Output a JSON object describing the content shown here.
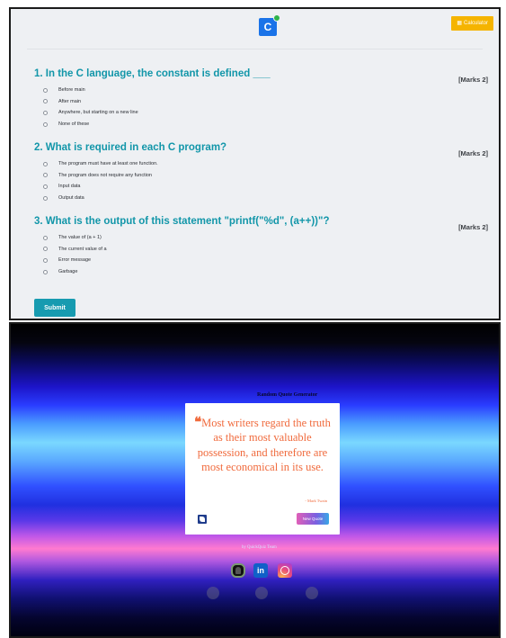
{
  "quiz": {
    "logo_letter": "C",
    "calculator_label": "Calculator",
    "questions": [
      {
        "title": "1. In the C language, the constant is defined ___",
        "marks": "[Marks 2]",
        "options": [
          "Before main",
          "After main",
          "Anywhere, but starting on a new line",
          "None of these"
        ]
      },
      {
        "title": "2. What is required in each C program?",
        "marks": "[Marks 2]",
        "options": [
          "The program must have at least one function.",
          "The program does not require any function",
          "Input data",
          "Output data"
        ]
      },
      {
        "title": "3. What is the output of this statement \"printf(\"%d\", (a++))\"?",
        "marks": "[Marks 2]",
        "options": [
          "The value of (a + 1)",
          "The current value of a",
          "Error message",
          "Garbage"
        ]
      }
    ],
    "submit_label": "Submit"
  },
  "quote_app": {
    "heading": "Random Quote Generator",
    "open_quote_glyph": "❝",
    "quote": "Most writers regard the truth as their most valuable possession, and therefore are most economical in its use.",
    "author": "- Mark Twain",
    "new_quote_label": "New Quote",
    "credit": "by QuickQuiz Team",
    "social": {
      "linkedin_glyph": "in"
    }
  },
  "colors": {
    "quiz_accent": "#1296a9",
    "calculator_button": "#f5b400",
    "quote_text": "#f06a3c"
  }
}
